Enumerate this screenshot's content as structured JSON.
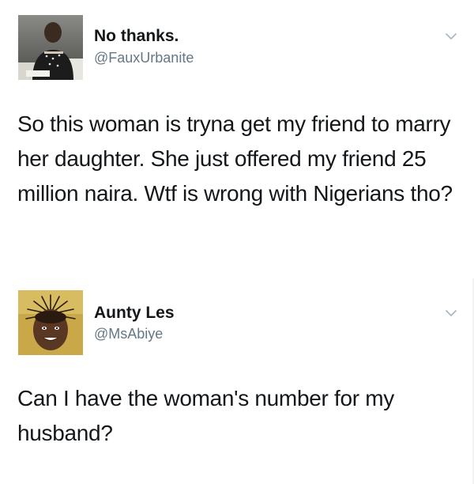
{
  "tweets": [
    {
      "display_name": "No thanks.",
      "handle": "@FauxUrbanite",
      "text": "So this woman is tryna get my friend to marry her daughter. She just offered my friend 25 million naira. Wtf is wrong with Nigerians tho?",
      "avatar_icon": "profile-photo-icon",
      "menu_icon": "chevron-down-icon"
    },
    {
      "display_name": "Aunty Les",
      "handle": "@MsAbiye",
      "text": "Can I have the woman's number for my husband?",
      "avatar_icon": "profile-photo-icon",
      "menu_icon": "chevron-down-icon"
    }
  ],
  "colors": {
    "text": "#14171a",
    "handle": "#657786",
    "chevron": "#aab8c2",
    "background": "#ffffff"
  }
}
